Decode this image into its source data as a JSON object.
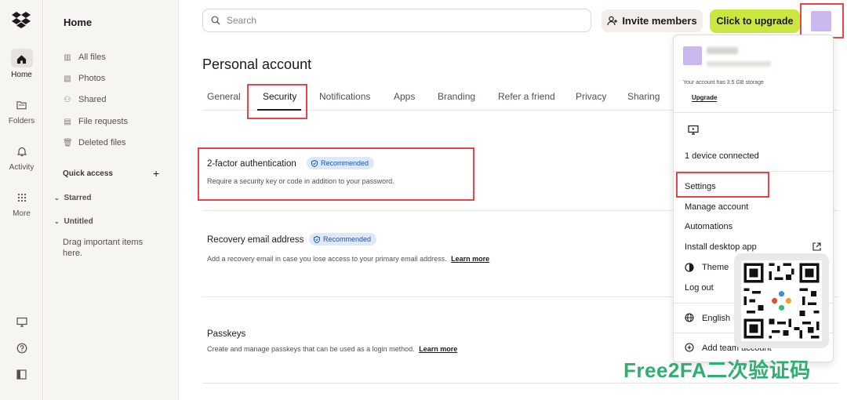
{
  "rail": {
    "items": [
      {
        "label": "Home",
        "icon": "home-icon"
      },
      {
        "label": "Folders",
        "icon": "folder-icon"
      },
      {
        "label": "Activity",
        "icon": "bell-icon"
      },
      {
        "label": "More",
        "icon": "grid-icon"
      }
    ],
    "bottom_icons": [
      "device-icon",
      "help-icon",
      "panel-icon"
    ]
  },
  "sidebar": {
    "title": "Home",
    "items": [
      {
        "label": "All files",
        "icon": "files-icon"
      },
      {
        "label": "Photos",
        "icon": "photo-icon"
      },
      {
        "label": "Shared",
        "icon": "shared-icon"
      },
      {
        "label": "File requests",
        "icon": "request-icon"
      },
      {
        "label": "Deleted files",
        "icon": "trash-icon"
      }
    ],
    "quick_access": "Quick access",
    "starred": "Starred",
    "untitled": "Untitled",
    "note": "Drag important items here."
  },
  "topbar": {
    "search_placeholder": "Search",
    "invite_label": "Invite members",
    "upgrade_label": "Click to upgrade"
  },
  "main": {
    "title": "Personal account",
    "tabs": [
      "General",
      "Security",
      "Notifications",
      "Apps",
      "Branding",
      "Refer a friend",
      "Privacy",
      "Sharing"
    ],
    "active_tab": "Security",
    "rows": [
      {
        "title": "2-factor authentication",
        "badge": "Recommended",
        "desc": "Require a security key or code in addition to your password.",
        "link": ""
      },
      {
        "title": "Recovery email address",
        "badge": "Recommended",
        "desc": "Add a recovery email in case you lose access to your primary email address.",
        "link": "Learn more"
      },
      {
        "title": "Passkeys",
        "badge": "",
        "desc": "Create and manage passkeys that can be used as a login method.",
        "link": "Learn more"
      }
    ]
  },
  "menu": {
    "storage_text": "Your account has 3.5 GB storage",
    "upgrade_link": "Upgrade",
    "devices": "1 device connected",
    "items": [
      "Settings",
      "Manage account",
      "Automations",
      "Install desktop app",
      "Theme",
      "Log out"
    ],
    "language": "English",
    "add_team": "Add team account"
  },
  "watermark": "Free2FA二次验证码",
  "colors": {
    "upgrade_bg": "#c9e73f",
    "badge_bg": "#dde8f8",
    "badge_text": "#1a56b0",
    "highlight_red": "#e8454a",
    "watermark_green": "#2fae72",
    "avatar": "#cbb8ee"
  }
}
